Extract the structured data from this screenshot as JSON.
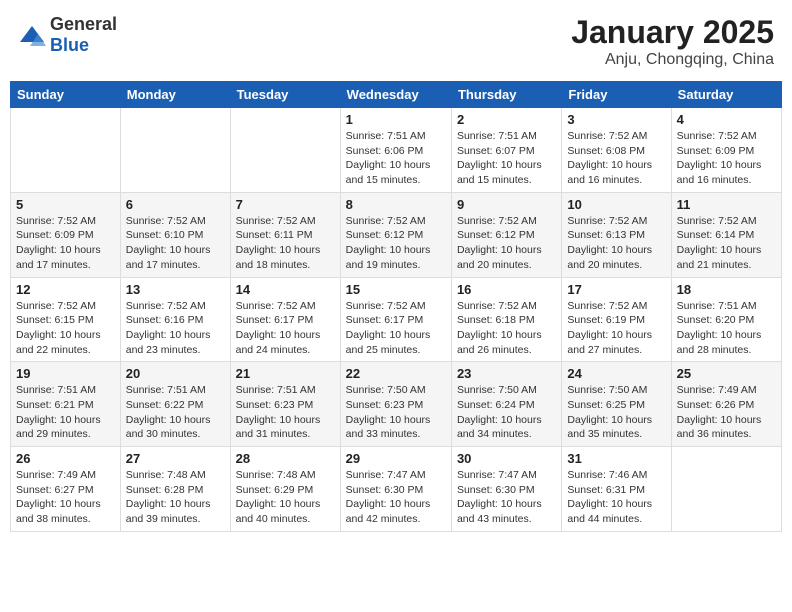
{
  "header": {
    "logo_general": "General",
    "logo_blue": "Blue",
    "month": "January 2025",
    "location": "Anju, Chongqing, China"
  },
  "days_of_week": [
    "Sunday",
    "Monday",
    "Tuesday",
    "Wednesday",
    "Thursday",
    "Friday",
    "Saturday"
  ],
  "weeks": [
    [
      {
        "day": "",
        "info": ""
      },
      {
        "day": "",
        "info": ""
      },
      {
        "day": "",
        "info": ""
      },
      {
        "day": "1",
        "info": "Sunrise: 7:51 AM\nSunset: 6:06 PM\nDaylight: 10 hours and 15 minutes."
      },
      {
        "day": "2",
        "info": "Sunrise: 7:51 AM\nSunset: 6:07 PM\nDaylight: 10 hours and 15 minutes."
      },
      {
        "day": "3",
        "info": "Sunrise: 7:52 AM\nSunset: 6:08 PM\nDaylight: 10 hours and 16 minutes."
      },
      {
        "day": "4",
        "info": "Sunrise: 7:52 AM\nSunset: 6:09 PM\nDaylight: 10 hours and 16 minutes."
      }
    ],
    [
      {
        "day": "5",
        "info": "Sunrise: 7:52 AM\nSunset: 6:09 PM\nDaylight: 10 hours and 17 minutes."
      },
      {
        "day": "6",
        "info": "Sunrise: 7:52 AM\nSunset: 6:10 PM\nDaylight: 10 hours and 17 minutes."
      },
      {
        "day": "7",
        "info": "Sunrise: 7:52 AM\nSunset: 6:11 PM\nDaylight: 10 hours and 18 minutes."
      },
      {
        "day": "8",
        "info": "Sunrise: 7:52 AM\nSunset: 6:12 PM\nDaylight: 10 hours and 19 minutes."
      },
      {
        "day": "9",
        "info": "Sunrise: 7:52 AM\nSunset: 6:12 PM\nDaylight: 10 hours and 20 minutes."
      },
      {
        "day": "10",
        "info": "Sunrise: 7:52 AM\nSunset: 6:13 PM\nDaylight: 10 hours and 20 minutes."
      },
      {
        "day": "11",
        "info": "Sunrise: 7:52 AM\nSunset: 6:14 PM\nDaylight: 10 hours and 21 minutes."
      }
    ],
    [
      {
        "day": "12",
        "info": "Sunrise: 7:52 AM\nSunset: 6:15 PM\nDaylight: 10 hours and 22 minutes."
      },
      {
        "day": "13",
        "info": "Sunrise: 7:52 AM\nSunset: 6:16 PM\nDaylight: 10 hours and 23 minutes."
      },
      {
        "day": "14",
        "info": "Sunrise: 7:52 AM\nSunset: 6:17 PM\nDaylight: 10 hours and 24 minutes."
      },
      {
        "day": "15",
        "info": "Sunrise: 7:52 AM\nSunset: 6:17 PM\nDaylight: 10 hours and 25 minutes."
      },
      {
        "day": "16",
        "info": "Sunrise: 7:52 AM\nSunset: 6:18 PM\nDaylight: 10 hours and 26 minutes."
      },
      {
        "day": "17",
        "info": "Sunrise: 7:52 AM\nSunset: 6:19 PM\nDaylight: 10 hours and 27 minutes."
      },
      {
        "day": "18",
        "info": "Sunrise: 7:51 AM\nSunset: 6:20 PM\nDaylight: 10 hours and 28 minutes."
      }
    ],
    [
      {
        "day": "19",
        "info": "Sunrise: 7:51 AM\nSunset: 6:21 PM\nDaylight: 10 hours and 29 minutes."
      },
      {
        "day": "20",
        "info": "Sunrise: 7:51 AM\nSunset: 6:22 PM\nDaylight: 10 hours and 30 minutes."
      },
      {
        "day": "21",
        "info": "Sunrise: 7:51 AM\nSunset: 6:23 PM\nDaylight: 10 hours and 31 minutes."
      },
      {
        "day": "22",
        "info": "Sunrise: 7:50 AM\nSunset: 6:23 PM\nDaylight: 10 hours and 33 minutes."
      },
      {
        "day": "23",
        "info": "Sunrise: 7:50 AM\nSunset: 6:24 PM\nDaylight: 10 hours and 34 minutes."
      },
      {
        "day": "24",
        "info": "Sunrise: 7:50 AM\nSunset: 6:25 PM\nDaylight: 10 hours and 35 minutes."
      },
      {
        "day": "25",
        "info": "Sunrise: 7:49 AM\nSunset: 6:26 PM\nDaylight: 10 hours and 36 minutes."
      }
    ],
    [
      {
        "day": "26",
        "info": "Sunrise: 7:49 AM\nSunset: 6:27 PM\nDaylight: 10 hours and 38 minutes."
      },
      {
        "day": "27",
        "info": "Sunrise: 7:48 AM\nSunset: 6:28 PM\nDaylight: 10 hours and 39 minutes."
      },
      {
        "day": "28",
        "info": "Sunrise: 7:48 AM\nSunset: 6:29 PM\nDaylight: 10 hours and 40 minutes."
      },
      {
        "day": "29",
        "info": "Sunrise: 7:47 AM\nSunset: 6:30 PM\nDaylight: 10 hours and 42 minutes."
      },
      {
        "day": "30",
        "info": "Sunrise: 7:47 AM\nSunset: 6:30 PM\nDaylight: 10 hours and 43 minutes."
      },
      {
        "day": "31",
        "info": "Sunrise: 7:46 AM\nSunset: 6:31 PM\nDaylight: 10 hours and 44 minutes."
      },
      {
        "day": "",
        "info": ""
      }
    ]
  ]
}
